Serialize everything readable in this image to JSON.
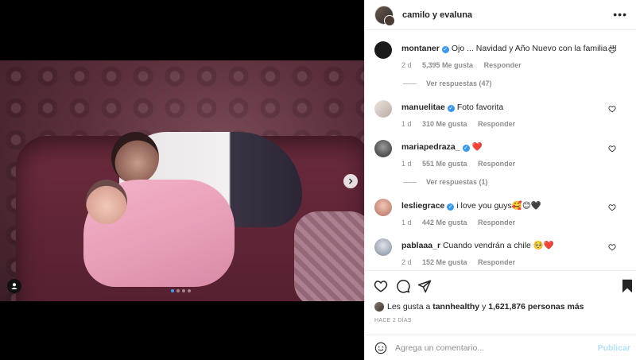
{
  "post": {
    "header_name": "camilo y evaluna",
    "more_icon": "more-horizontal-icon"
  },
  "comments": [
    {
      "user": "montaner",
      "verified": true,
      "text": "Ojo ... Navidad y Año Nuevo con la familia !!!",
      "age": "2 d",
      "likes": "5,395 Me gusta",
      "reply": "Responder",
      "replies_label": "Ver respuestas (47)",
      "avatar_color": "#1a1a1a"
    },
    {
      "user": "manuelitae",
      "verified": true,
      "text": "Foto favorita",
      "age": "1 d",
      "likes": "310 Me gusta",
      "reply": "Responder",
      "avatar_color": "#d9cfc9"
    },
    {
      "user": "mariapedraza_",
      "verified": true,
      "text": "❤️",
      "age": "1 d",
      "likes": "551 Me gusta",
      "reply": "Responder",
      "replies_label": "Ver respuestas (1)",
      "avatar_color": "#2e2e2e"
    },
    {
      "user": "lesliegrace",
      "verified": true,
      "text": "i love you guys🥰😊🖤",
      "age": "1 d",
      "likes": "442 Me gusta",
      "reply": "Responder",
      "avatar_color": "#c98a7a"
    },
    {
      "user": "pablaaa_r",
      "verified": false,
      "text": "Cuando vendrán a chile 🥺❤️",
      "age": "2 d",
      "likes": "152 Me gusta",
      "reply": "Responder",
      "avatar_color": "#9fa9b8"
    }
  ],
  "likes_summary": {
    "prefix": "Les gusta a",
    "user": "tannhealthy",
    "mid": "y",
    "count": "1,621,876 personas más"
  },
  "time_ago": "HACE 2 DÍAS",
  "composer": {
    "placeholder": "Agrega un comentario...",
    "post_label": "Publicar"
  },
  "carousel": {
    "total": 4,
    "active": 1
  },
  "colors": {
    "accent": "#3897f0",
    "post_disabled": "#b2dffc",
    "muted": "#8e8e8e"
  }
}
